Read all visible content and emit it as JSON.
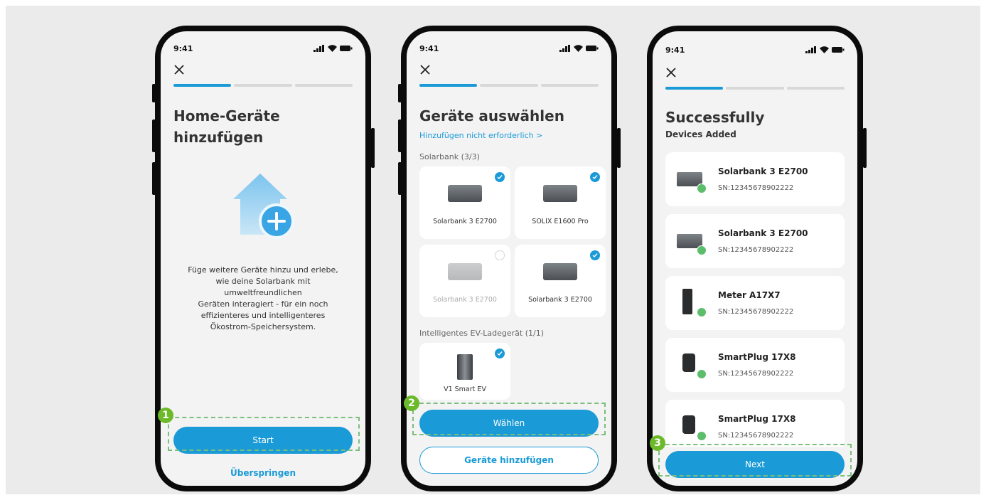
{
  "status_bar": {
    "time": "9:41"
  },
  "screen1": {
    "title_line1": "Home-Geräte",
    "title_line2": "hinzufügen",
    "description": [
      "Füge weitere Geräte hinzu und erlebe,",
      "wie deine Solarbank mit",
      "umweltfreundlichen",
      "Geräten interagiert - für ein noch",
      "effizienteres und intelligenteres",
      "Ökostrom-Speichersystem."
    ],
    "start_label": "Start",
    "skip_label": "Überspringen",
    "step_badge": "1"
  },
  "screen2": {
    "title": "Geräte auswählen",
    "not_required_link": "Hinzufügen nicht erforderlich >",
    "section_solarbank": "Solarbank (3/3)",
    "devices": [
      {
        "label": "Solarbank 3 E2700",
        "selected": true
      },
      {
        "label": "SOLIX E1600 Pro",
        "selected": true
      },
      {
        "label": "Solarbank 3 E2700",
        "selected": false
      },
      {
        "label": "Solarbank 3 E2700",
        "selected": true
      }
    ],
    "section_ev": "Intelligentes EV-Ladegerät (1/1)",
    "ev_device": {
      "label": "V1 Smart EV",
      "selected": true
    },
    "choose_label": "Wählen",
    "add_devices_label": "Geräte hinzufügen",
    "step_badge": "2"
  },
  "screen3": {
    "title": "Successfully",
    "subtitle": "Devices Added",
    "devices": [
      {
        "name": "Solarbank 3 E2700",
        "sn": "SN:12345678902222",
        "icon": "solarbank-icon"
      },
      {
        "name": "Solarbank 3 E2700",
        "sn": "SN:12345678902222",
        "icon": "solarbank-icon"
      },
      {
        "name": "Meter A17X7",
        "sn": "SN:12345678902222",
        "icon": "meter-icon"
      },
      {
        "name": "SmartPlug 17X8",
        "sn": "SN:12345678902222",
        "icon": "smartplug-icon"
      },
      {
        "name": "SmartPlug 17X8",
        "sn": "SN:12345678902222",
        "icon": "smartplug-icon"
      }
    ],
    "next_label": "Next",
    "step_badge": "3"
  },
  "colors": {
    "accent": "#1a9ad6",
    "badge": "#6cba2a",
    "success": "#5cbd6a"
  }
}
